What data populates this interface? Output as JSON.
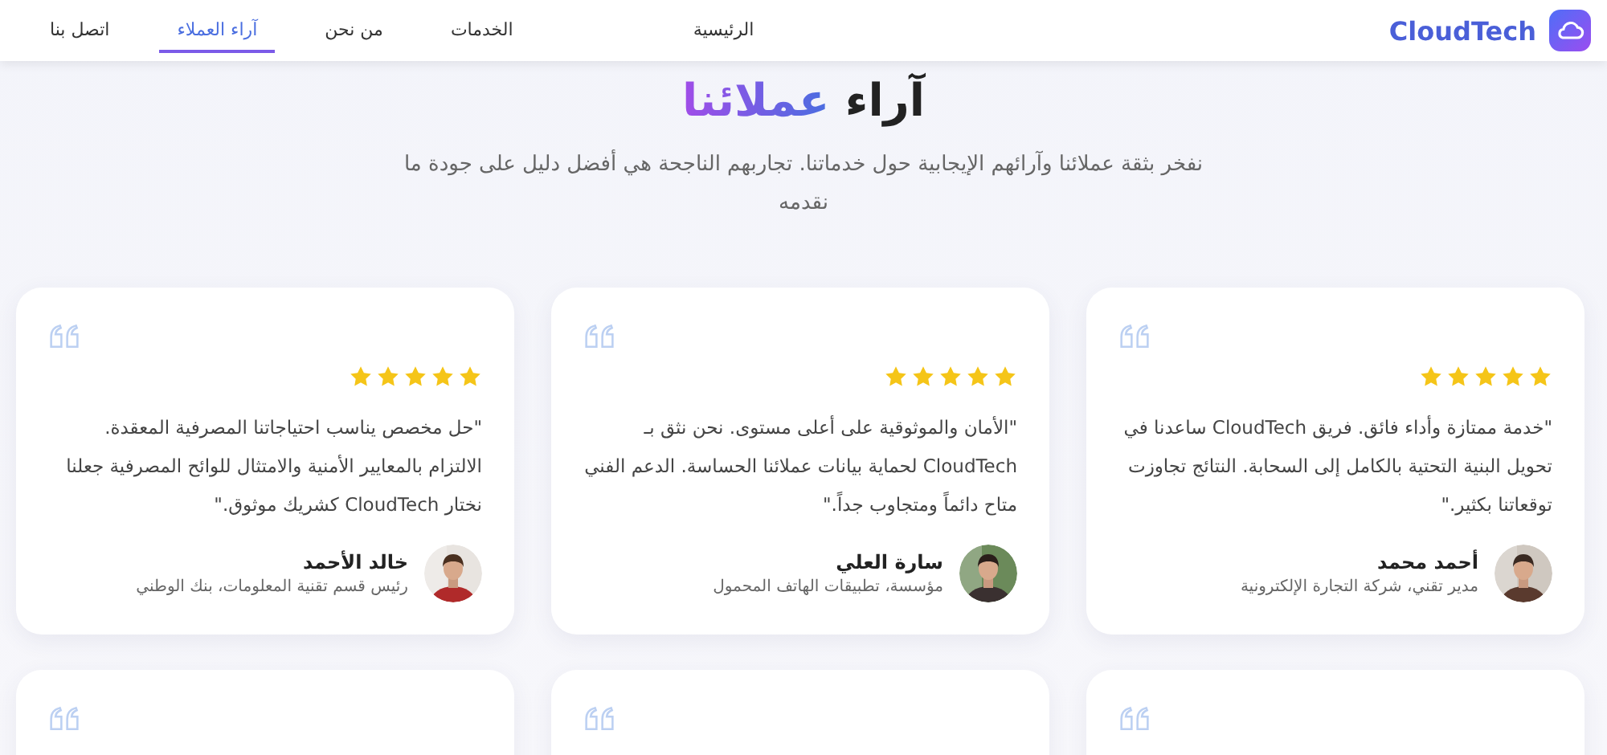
{
  "brand": {
    "name": "CloudTech"
  },
  "nav": [
    {
      "label": "الرئيسية",
      "selected": false
    },
    {
      "label": "الخدمات",
      "selected": false
    },
    {
      "label": "من نحن",
      "selected": false
    },
    {
      "label": "آراء العملاء",
      "selected": true
    },
    {
      "label": "اتصل بنا",
      "selected": false
    }
  ],
  "hero": {
    "title_start": "آراء",
    "title_highlight": "عملائنا",
    "subtitle": "نفخر بثقة عملائنا وآرائهم الإيجابية حول خدماتنا. تجاربهم الناجحة هي أفضل دليل على جودة ما نقدمه"
  },
  "testimonials": [
    {
      "kind": "full",
      "stars": 5,
      "quote": "\"خدمة ممتازة وأداء فائق. فريق CloudTech ساعدنا في تحويل البنية التحتية بالكامل إلى السحابة. النتائج تجاوزت توقعاتنا بكثير.\"",
      "name": "أحمد محمد",
      "role": "مدير تقني، شركة التجارة الإلكترونية"
    },
    {
      "kind": "full",
      "stars": 5,
      "quote": "\"الأمان والموثوقية على أعلى مستوى. نحن نثق بـ CloudTech لحماية بيانات عملائنا الحساسة. الدعم الفني متاح دائماً ومتجاوب جداً.\"",
      "name": "سارة العلي",
      "role": "مؤسسة، تطبيقات الهاتف المحمول"
    },
    {
      "kind": "full",
      "stars": 5,
      "quote": "\"حل مخصص يناسب احتياجاتنا المصرفية المعقدة. الالتزام بالمعايير الأمنية والامتثال للوائح المصرفية جعلنا نختار CloudTech كشريك موثوق.\"",
      "name": "خالد الأحمد",
      "role": "رئيس قسم تقنية المعلومات، بنك الوطني"
    },
    {
      "kind": "partial"
    },
    {
      "kind": "partial"
    },
    {
      "kind": "partial"
    }
  ]
}
